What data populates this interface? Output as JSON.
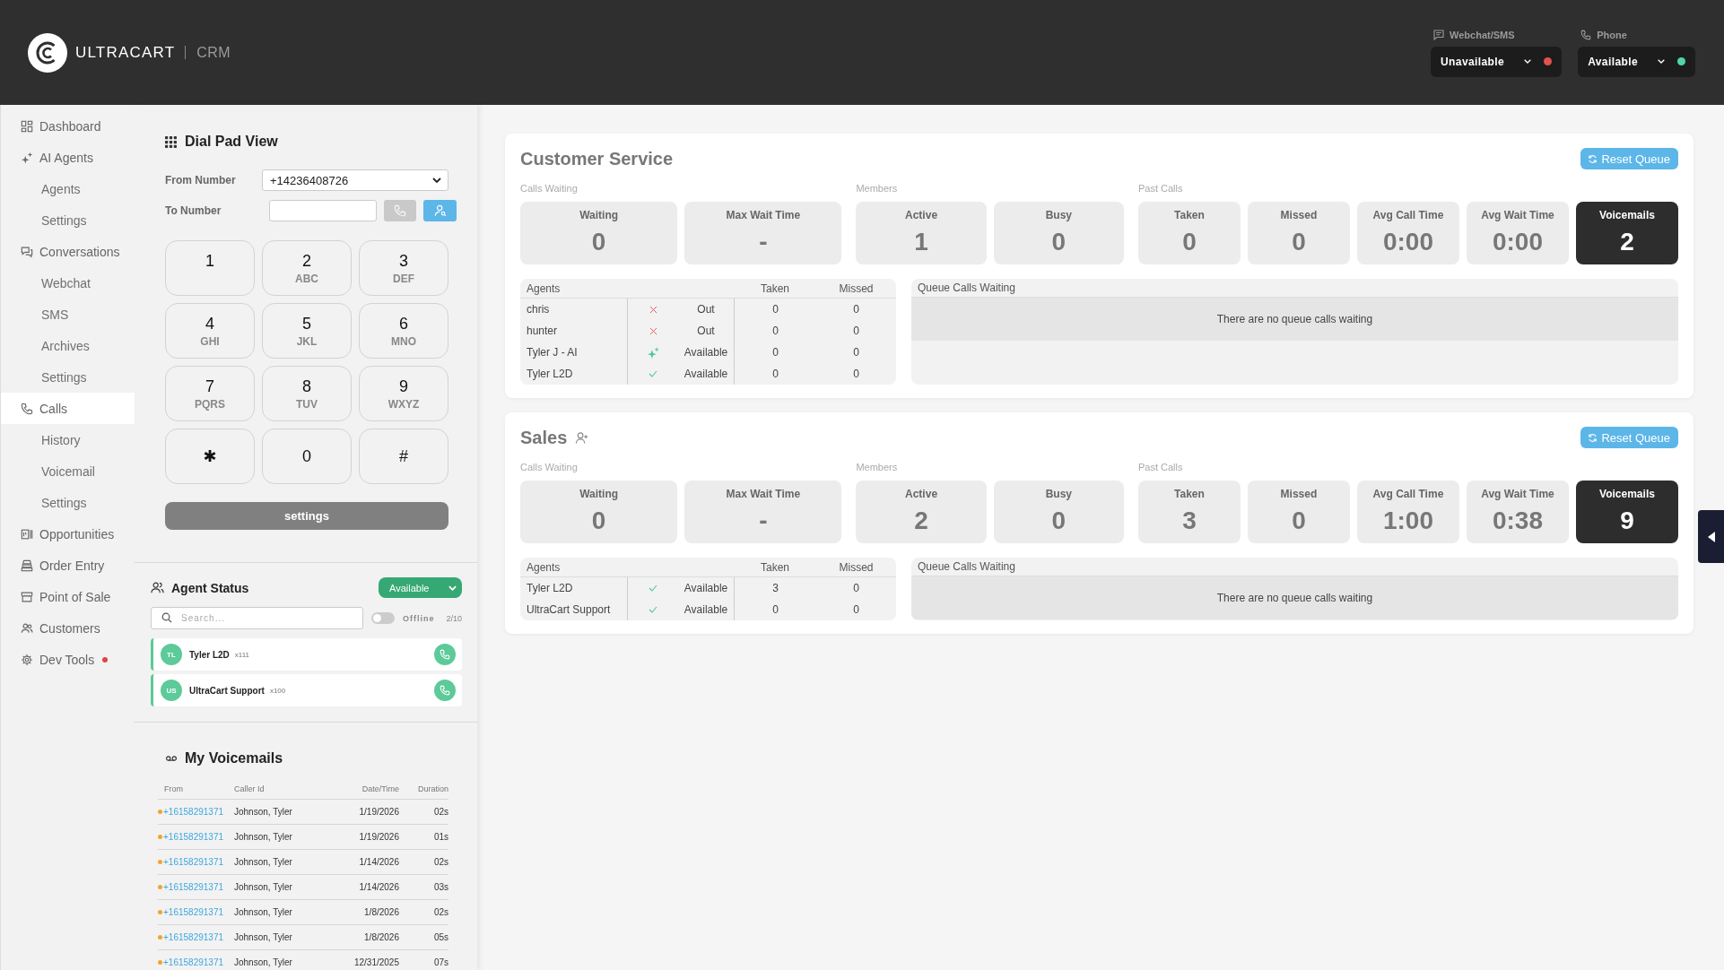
{
  "header": {
    "brand": "ULTRACART",
    "product": "CRM",
    "channels": [
      {
        "label": "Webchat/SMS",
        "kind": "chat",
        "status": "Unavailable",
        "color": "#e05252"
      },
      {
        "label": "Phone",
        "kind": "phone",
        "status": "Available",
        "color": "#4fd6a3"
      }
    ]
  },
  "sidebar": {
    "items": [
      {
        "label": "Dashboard",
        "selected": false,
        "alert": false
      },
      {
        "label": "AI Agents",
        "selected": false,
        "alert": false,
        "children": [
          {
            "label": "Agents",
            "selected": false
          },
          {
            "label": "Settings",
            "selected": false
          }
        ]
      },
      {
        "label": "Conversations",
        "selected": false,
        "alert": false,
        "children": [
          {
            "label": "Webchat",
            "selected": false
          },
          {
            "label": "SMS",
            "selected": false
          },
          {
            "label": "Archives",
            "selected": false
          },
          {
            "label": "Settings",
            "selected": false
          }
        ]
      },
      {
        "label": "Calls",
        "selected": true,
        "alert": false,
        "children": [
          {
            "label": "History",
            "selected": false
          },
          {
            "label": "Voicemail",
            "selected": false
          },
          {
            "label": "Settings",
            "selected": false
          }
        ]
      },
      {
        "label": "Opportunities",
        "selected": false,
        "alert": false
      },
      {
        "label": "Order Entry",
        "selected": false,
        "alert": false
      },
      {
        "label": "Point of Sale",
        "selected": false,
        "alert": false
      },
      {
        "label": "Customers",
        "selected": false,
        "alert": false
      },
      {
        "label": "Dev Tools",
        "selected": false,
        "alert": true
      }
    ]
  },
  "dial_pad": {
    "title": "Dial Pad View",
    "from_label": "From Number",
    "from_value": "+14236408726",
    "to_label": "To Number",
    "call_disabled": true,
    "keys": [
      {
        "digit": "1"
      },
      {
        "digit": "2",
        "letters": "ABC"
      },
      {
        "digit": "3",
        "letters": "DEF"
      },
      {
        "digit": "4",
        "letters": "GHI"
      },
      {
        "digit": "5",
        "letters": "JKL"
      },
      {
        "digit": "6",
        "letters": "MNO"
      },
      {
        "digit": "7",
        "letters": "PQRS"
      },
      {
        "digit": "8",
        "letters": "TUV"
      },
      {
        "digit": "9",
        "letters": "WXYZ"
      },
      {
        "digit": "✱"
      },
      {
        "digit": "0"
      },
      {
        "digit": "#"
      }
    ],
    "settings_button": "settings"
  },
  "agent_status": {
    "title": "Agent Status",
    "status": "Available",
    "search_placeholder": "Search...",
    "offline_label": "Offline",
    "show_offline": false,
    "count": "2/10",
    "agents": [
      {
        "initials": "TL",
        "name": "Tyler L2D",
        "extension": "x111"
      },
      {
        "initials": "US",
        "name": "UltraCart Support",
        "extension": "x100"
      }
    ]
  },
  "voicemails": {
    "title": "My Voicemails",
    "columns": [
      "From",
      "Caller Id",
      "Date/Time",
      "Duration"
    ],
    "rows": [
      {
        "from": "+16158291371",
        "caller_id": "Johnson, Tyler",
        "date_time": "1/19/2026",
        "duration": "02s",
        "unread": true
      },
      {
        "from": "+16158291371",
        "caller_id": "Johnson, Tyler",
        "date_time": "1/19/2026",
        "duration": "01s",
        "unread": true
      },
      {
        "from": "+16158291371",
        "caller_id": "Johnson, Tyler",
        "date_time": "1/14/2026",
        "duration": "02s",
        "unread": true
      },
      {
        "from": "+16158291371",
        "caller_id": "Johnson, Tyler",
        "date_time": "1/14/2026",
        "duration": "03s",
        "unread": true
      },
      {
        "from": "+16158291371",
        "caller_id": "Johnson, Tyler",
        "date_time": "1/8/2026",
        "duration": "02s",
        "unread": true
      },
      {
        "from": "+16158291371",
        "caller_id": "Johnson, Tyler",
        "date_time": "1/8/2026",
        "duration": "05s",
        "unread": true
      },
      {
        "from": "+16158291371",
        "caller_id": "Johnson, Tyler",
        "date_time": "12/31/2025",
        "duration": "07s",
        "unread": true
      }
    ]
  },
  "queues": [
    {
      "name": "Customer Service",
      "show_add_member": false,
      "reset_button": "Reset Queue",
      "groups": [
        {
          "label": "Calls Waiting",
          "stats": [
            {
              "label": "Waiting",
              "value": "0",
              "highlighted": false
            },
            {
              "label": "Max Wait Time",
              "value": "-",
              "highlighted": false
            }
          ]
        },
        {
          "label": "Members",
          "stats": [
            {
              "label": "Active",
              "value": "1",
              "highlighted": false
            },
            {
              "label": "Busy",
              "value": "0",
              "highlighted": false
            }
          ]
        },
        {
          "label": "Past Calls",
          "stats": [
            {
              "label": "Taken",
              "value": "0",
              "highlighted": false
            },
            {
              "label": "Missed",
              "value": "0",
              "highlighted": false
            },
            {
              "label": "Avg Call Time",
              "value": "0:00",
              "highlighted": false
            },
            {
              "label": "Avg Wait Time",
              "value": "0:00",
              "highlighted": false
            },
            {
              "label": "Voicemails",
              "value": "2",
              "highlighted": true
            }
          ]
        }
      ],
      "agents_table": {
        "columns": [
          "Agents",
          "Taken",
          "Missed"
        ],
        "rows": [
          {
            "name": "chris",
            "kind": "out",
            "status": "Out",
            "taken": "0",
            "missed": "0"
          },
          {
            "name": "hunter",
            "kind": "out",
            "status": "Out",
            "taken": "0",
            "missed": "0"
          },
          {
            "name": "Tyler J - AI",
            "kind": "ai",
            "status": "Available",
            "taken": "0",
            "missed": "0"
          },
          {
            "name": "Tyler L2D",
            "kind": "available",
            "status": "Available",
            "taken": "0",
            "missed": "0"
          }
        ]
      },
      "queue_calls": {
        "title": "Queue Calls Waiting",
        "empty_text": "There are no queue calls waiting"
      }
    },
    {
      "name": "Sales",
      "show_add_member": true,
      "reset_button": "Reset Queue",
      "groups": [
        {
          "label": "Calls Waiting",
          "stats": [
            {
              "label": "Waiting",
              "value": "0",
              "highlighted": false
            },
            {
              "label": "Max Wait Time",
              "value": "-",
              "highlighted": false
            }
          ]
        },
        {
          "label": "Members",
          "stats": [
            {
              "label": "Active",
              "value": "2",
              "highlighted": false
            },
            {
              "label": "Busy",
              "value": "0",
              "highlighted": false
            }
          ]
        },
        {
          "label": "Past Calls",
          "stats": [
            {
              "label": "Taken",
              "value": "3",
              "highlighted": false
            },
            {
              "label": "Missed",
              "value": "0",
              "highlighted": false
            },
            {
              "label": "Avg Call Time",
              "value": "1:00",
              "highlighted": false
            },
            {
              "label": "Avg Wait Time",
              "value": "0:38",
              "highlighted": false
            },
            {
              "label": "Voicemails",
              "value": "9",
              "highlighted": true
            }
          ]
        }
      ],
      "agents_table": {
        "columns": [
          "Agents",
          "Taken",
          "Missed"
        ],
        "rows": [
          {
            "name": "Tyler L2D",
            "kind": "available",
            "status": "Available",
            "taken": "3",
            "missed": "0"
          },
          {
            "name": "UltraCart Support",
            "kind": "available",
            "status": "Available",
            "taken": "0",
            "missed": "0"
          }
        ]
      },
      "queue_calls": {
        "title": "Queue Calls Waiting",
        "empty_text": "There are no queue calls waiting"
      }
    }
  ]
}
